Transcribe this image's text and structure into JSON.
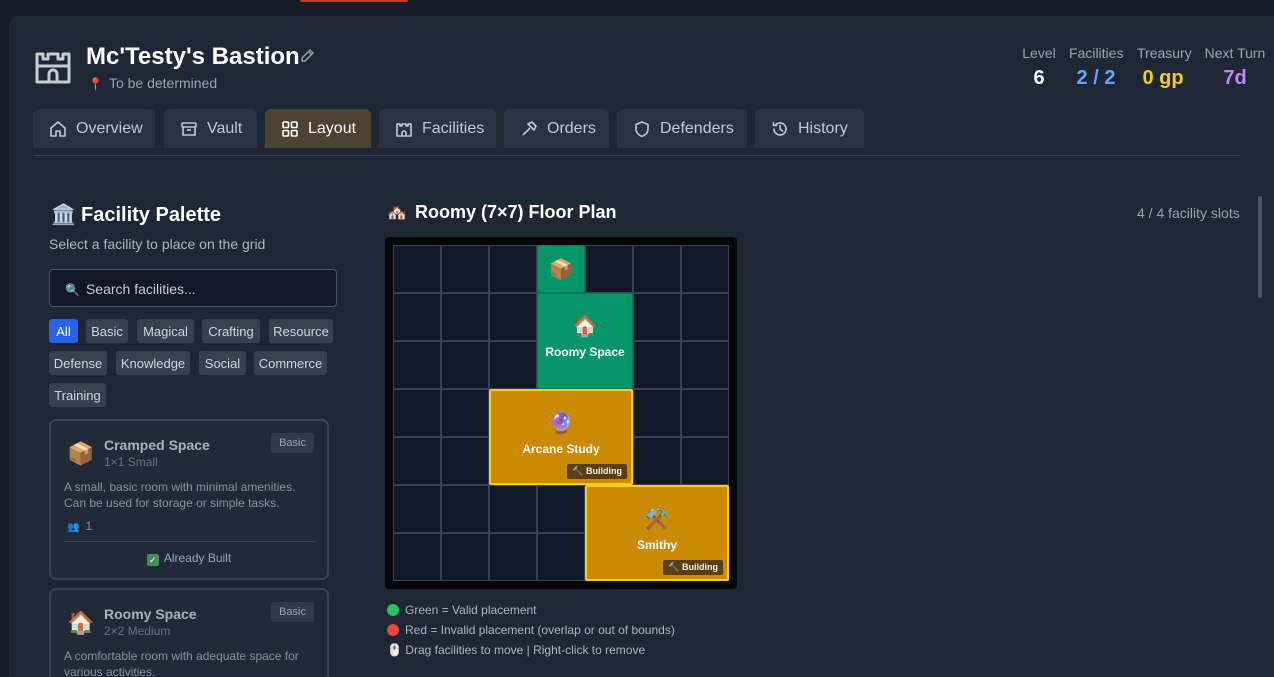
{
  "header": {
    "title": "Mc'Testy's Bastion",
    "location": "To be determined",
    "stats": [
      {
        "label": "Level",
        "value": "6",
        "color": "#ffffff"
      },
      {
        "label": "Facilities",
        "value": "2 / 2",
        "color": "#60a5fa"
      },
      {
        "label": "Treasury",
        "value": "0 gp",
        "color": "#facc15"
      },
      {
        "label": "Next Turn",
        "value": "7d",
        "color": "#c084fc"
      }
    ]
  },
  "tabs": [
    {
      "label": "Overview",
      "icon": "home-icon"
    },
    {
      "label": "Vault",
      "icon": "archive-icon"
    },
    {
      "label": "Layout",
      "icon": "grid-icon",
      "active": true
    },
    {
      "label": "Facilities",
      "icon": "castle-icon"
    },
    {
      "label": "Orders",
      "icon": "hammer-icon"
    },
    {
      "label": "Defenders",
      "icon": "shield-icon"
    },
    {
      "label": "History",
      "icon": "history-icon"
    }
  ],
  "palette": {
    "title": "Facility Palette",
    "subtitle": "Select a facility to place on the grid",
    "search_placeholder": "Search facilities...",
    "filters": [
      "All",
      "Basic",
      "Magical",
      "Crafting",
      "Resource",
      "Defense",
      "Knowledge",
      "Social",
      "Commerce",
      "Training"
    ],
    "cards": [
      {
        "icon": "📦",
        "name": "Cramped Space",
        "size": "1×1 Small",
        "badge": "Basic",
        "description": "A small, basic room with minimal amenities. Can be used for storage or simple tasks.",
        "occupants": "1",
        "status": "Already Built"
      },
      {
        "icon": "🏠",
        "name": "Roomy Space",
        "size": "2×2 Medium",
        "badge": "Basic",
        "description": "A comfortable room with adequate space for various activities."
      }
    ]
  },
  "floorplan": {
    "title": "Roomy (7×7) Floor Plan",
    "slots": "4 / 4 facility slots",
    "grid_size": 7,
    "facilities": [
      {
        "name": "",
        "icon": "📦",
        "col": 3,
        "row": 0,
        "w": 1,
        "h": 1,
        "state": "valid"
      },
      {
        "name": "Roomy Space",
        "icon": "🏠",
        "col": 3,
        "row": 1,
        "w": 2,
        "h": 2,
        "state": "valid"
      },
      {
        "name": "Arcane Study",
        "icon": "🔮",
        "col": 2,
        "row": 3,
        "w": 3,
        "h": 2,
        "state": "building",
        "badge": "🔨 Building"
      },
      {
        "name": "Smithy",
        "icon": "⚒️",
        "col": 4,
        "row": 5,
        "w": 3,
        "h": 2,
        "state": "building",
        "badge": "🔨 Building"
      }
    ],
    "legend": [
      {
        "text": "Green = Valid placement",
        "color": "#22c55e"
      },
      {
        "text": "Red = Invalid placement (overlap or out of bounds)",
        "color": "#ef4444"
      },
      {
        "text": "🖱️ Drag facilities to move | Right-click to remove",
        "color": ""
      }
    ]
  }
}
